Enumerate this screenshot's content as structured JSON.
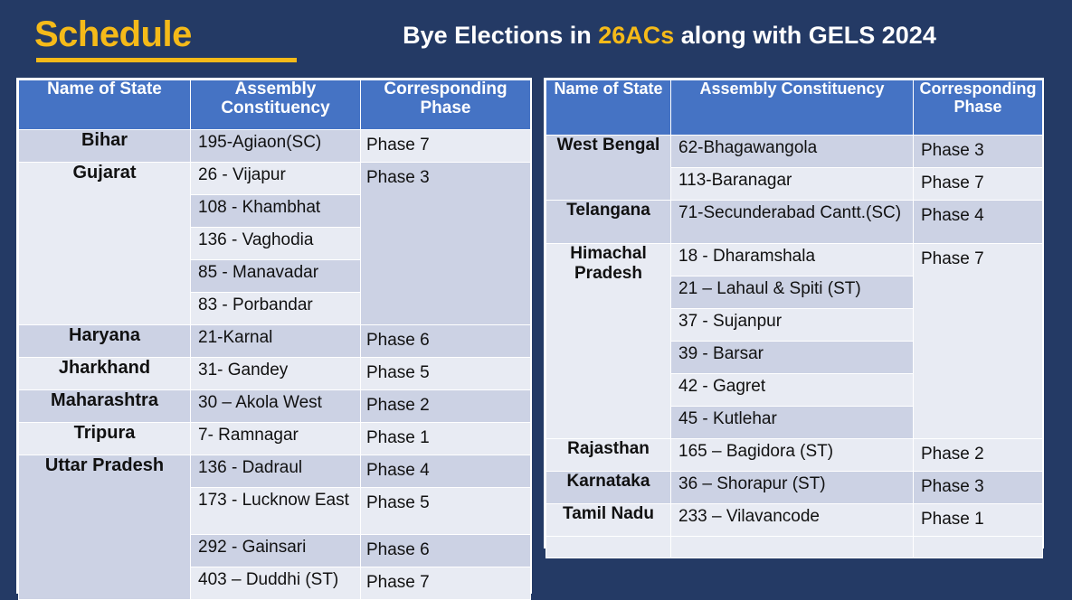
{
  "header": {
    "schedule_label": "Schedule",
    "title_part1": "Bye Elections in ",
    "title_highlight": "26ACs",
    "title_part2": " along with GELS 2024",
    "gold": "#f5ba19",
    "navy": "#243a65",
    "header_blue": "#4573c4"
  },
  "left_table": {
    "columns": [
      "Name of State",
      "Assembly Constituency",
      "Corresponding Phase"
    ],
    "rows": [
      {
        "state": "Bihar",
        "ac": "195-Agiaon(SC)",
        "phase": "Phase 7"
      },
      {
        "state": "Gujarat",
        "ac": "26 - Vijapur",
        "phase": "Phase 3"
      },
      {
        "state": "",
        "ac": "108 - Khambhat",
        "phase": ""
      },
      {
        "state": "",
        "ac": "136 - Vaghodia",
        "phase": ""
      },
      {
        "state": "",
        "ac": "85 - Manavadar",
        "phase": ""
      },
      {
        "state": "",
        "ac": "83 - Porbandar",
        "phase": ""
      },
      {
        "state": "Haryana",
        "ac": "21-Karnal",
        "phase": "Phase 6"
      },
      {
        "state": "Jharkhand",
        "ac": "31- Gandey",
        "phase": "Phase 5"
      },
      {
        "state": "Maharashtra",
        "ac": "30 – Akola West",
        "phase": "Phase 2"
      },
      {
        "state": "Tripura",
        "ac": "7- Ramnagar",
        "phase": "Phase 1"
      },
      {
        "state": "Uttar Pradesh",
        "ac": "136 - Dadraul",
        "phase": "Phase 4"
      },
      {
        "state": "",
        "ac": "173 - Lucknow East",
        "phase": "Phase 5"
      },
      {
        "state": "",
        "ac": "292 - Gainsari",
        "phase": "Phase 6"
      },
      {
        "state": "",
        "ac": "403 – Duddhi (ST)",
        "phase": "Phase 7"
      }
    ]
  },
  "right_table": {
    "columns": [
      "Name of State",
      "Assembly Constituency",
      "Corresponding Phase"
    ],
    "rows": [
      {
        "state": "West Bengal",
        "ac": "62-Bhagawangola",
        "phase": "Phase 3"
      },
      {
        "state": "",
        "ac": "113-Baranagar",
        "phase": "Phase 7"
      },
      {
        "state": "Telangana",
        "ac": "71-Secunderabad Cantt.(SC)",
        "phase": "Phase 4"
      },
      {
        "state": "Himachal Pradesh",
        "ac": "18 - Dharamshala",
        "phase": "Phase 7"
      },
      {
        "state": "",
        "ac": "21 – Lahaul & Spiti (ST)",
        "phase": ""
      },
      {
        "state": "",
        "ac": "37 - Sujanpur",
        "phase": ""
      },
      {
        "state": "",
        "ac": "39 - Barsar",
        "phase": ""
      },
      {
        "state": "",
        "ac": "42 - Gagret",
        "phase": ""
      },
      {
        "state": "",
        "ac": "45 - Kutlehar",
        "phase": ""
      },
      {
        "state": "Rajasthan",
        "ac": "165 – Bagidora (ST)",
        "phase": "Phase 2"
      },
      {
        "state": "Karnataka",
        "ac": "36 – Shorapur (ST)",
        "phase": "Phase 3"
      },
      {
        "state": "Tamil Nadu",
        "ac": "233 – Vilavancode",
        "phase": "Phase 1"
      }
    ]
  }
}
